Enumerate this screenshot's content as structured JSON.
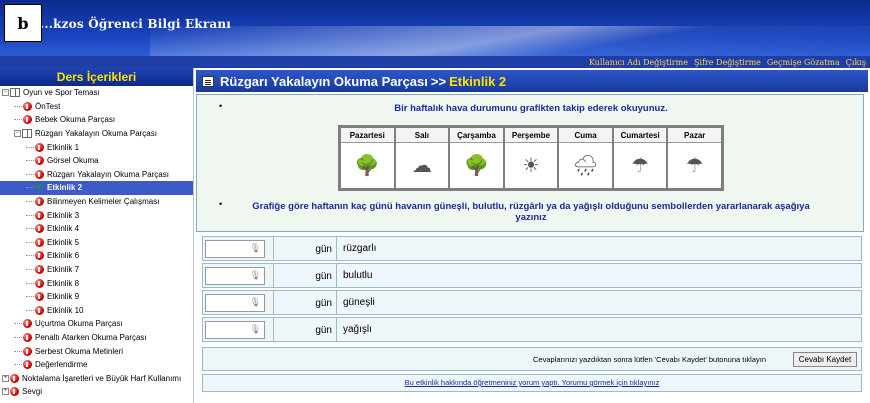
{
  "badge": "b",
  "header": {
    "title": "...kzos Öğrenci Bilgi Ekranı"
  },
  "topbar": {
    "links": [
      "Kullanıcı Adı Değiştirme",
      "Şifre Değiştirme",
      "Geçmişe Gözatma",
      "Çıkış"
    ]
  },
  "sidebar": {
    "title": "Ders İçerikleri",
    "items": [
      {
        "label": "Oyun ve Spor Teması",
        "level": 0,
        "icon": "book"
      },
      {
        "label": "ÖnTest",
        "level": 1,
        "icon": "red"
      },
      {
        "label": "Bebek Okuma Parçası",
        "level": 1,
        "icon": "red"
      },
      {
        "label": "Rüzgarı Yakalayın Okuma Parçası",
        "level": 1,
        "icon": "book"
      },
      {
        "label": "Etkinlik 1",
        "level": 2,
        "icon": "red"
      },
      {
        "label": "Görsel Okuma",
        "level": 2,
        "icon": "red"
      },
      {
        "label": "Rüzgarı Yakalayın Okuma Parçası",
        "level": 2,
        "icon": "red"
      },
      {
        "label": "Etkinlik 2",
        "level": 2,
        "icon": "check",
        "active": true
      },
      {
        "label": "Bilinmeyen Kelimeler Çalışması",
        "level": 2,
        "icon": "red"
      },
      {
        "label": "Etkinlik 3",
        "level": 2,
        "icon": "red"
      },
      {
        "label": "Etkinlik 4",
        "level": 2,
        "icon": "red"
      },
      {
        "label": "Etkinlik 5",
        "level": 2,
        "icon": "red"
      },
      {
        "label": "Etkinlik 6",
        "level": 2,
        "icon": "red"
      },
      {
        "label": "Etkinlik 7",
        "level": 2,
        "icon": "red"
      },
      {
        "label": "Etkinlik 8",
        "level": 2,
        "icon": "red"
      },
      {
        "label": "Etkinlik 9",
        "level": 2,
        "icon": "red"
      },
      {
        "label": "Etkinlik 10",
        "level": 2,
        "icon": "red"
      },
      {
        "label": "Uçurtma Okuma Parçası",
        "level": 1,
        "icon": "red"
      },
      {
        "label": "Penaltı Atarken Okuma Parçası",
        "level": 1,
        "icon": "red"
      },
      {
        "label": "Serbest Okuma Metinleri",
        "level": 1,
        "icon": "red"
      },
      {
        "label": "Değerlendirme",
        "level": 1,
        "icon": "red"
      },
      {
        "label": "Noktalama İşaretleri ve Büyük Harf Kullanımı",
        "level": 0,
        "icon": "red"
      },
      {
        "label": "Sevgi",
        "level": 0,
        "icon": "red"
      }
    ]
  },
  "main": {
    "title": "Rüzgarı Yakalayın Okuma Parçası",
    "separator": ">>",
    "subtitle": "Etkinlik 2",
    "instruction1": "Bir haftalık hava durumunu grafikten takip ederek okuyunuz.",
    "instruction2": "Grafiğe göre haftanın kaç günü havanın güneşli, bulutlu, rüzgârlı ya da yağışlı olduğunu sembollerden yararlanarak aşağıya yazınız",
    "days": [
      {
        "name": "Pazartesi",
        "icon": "windy-tree-icon",
        "glyph": "🌳"
      },
      {
        "name": "Salı",
        "icon": "cloud-icon",
        "glyph": "☁"
      },
      {
        "name": "Çarşamba",
        "icon": "windy-tree-icon",
        "glyph": "🌳"
      },
      {
        "name": "Perşembe",
        "icon": "sun-icon",
        "glyph": "☀"
      },
      {
        "name": "Cuma",
        "icon": "rain-icon",
        "glyph": "🌧"
      },
      {
        "name": "Cumartesi",
        "icon": "rain-umbrella-icon",
        "glyph": "☂"
      },
      {
        "name": "Pazar",
        "icon": "rain-umbrella-icon",
        "glyph": "☂"
      }
    ],
    "answers": [
      {
        "unit": "gün",
        "label": "rüzgarlı",
        "value": ""
      },
      {
        "unit": "gün",
        "label": "bulutlu",
        "value": ""
      },
      {
        "unit": "gün",
        "label": "güneşli",
        "value": ""
      },
      {
        "unit": "gün",
        "label": "yağışlı",
        "value": ""
      }
    ],
    "submit_note": "Cevaplarınızı yazdıktan sonra lütfen 'Cevabı Kaydet' butonuna tıklayın",
    "submit_label": "Cevabı Kaydet",
    "feedback_link": "Bu etkinlik hakkında öğretmeniniz yorum yaptı. Yorumu görmek için tıklayınız"
  }
}
